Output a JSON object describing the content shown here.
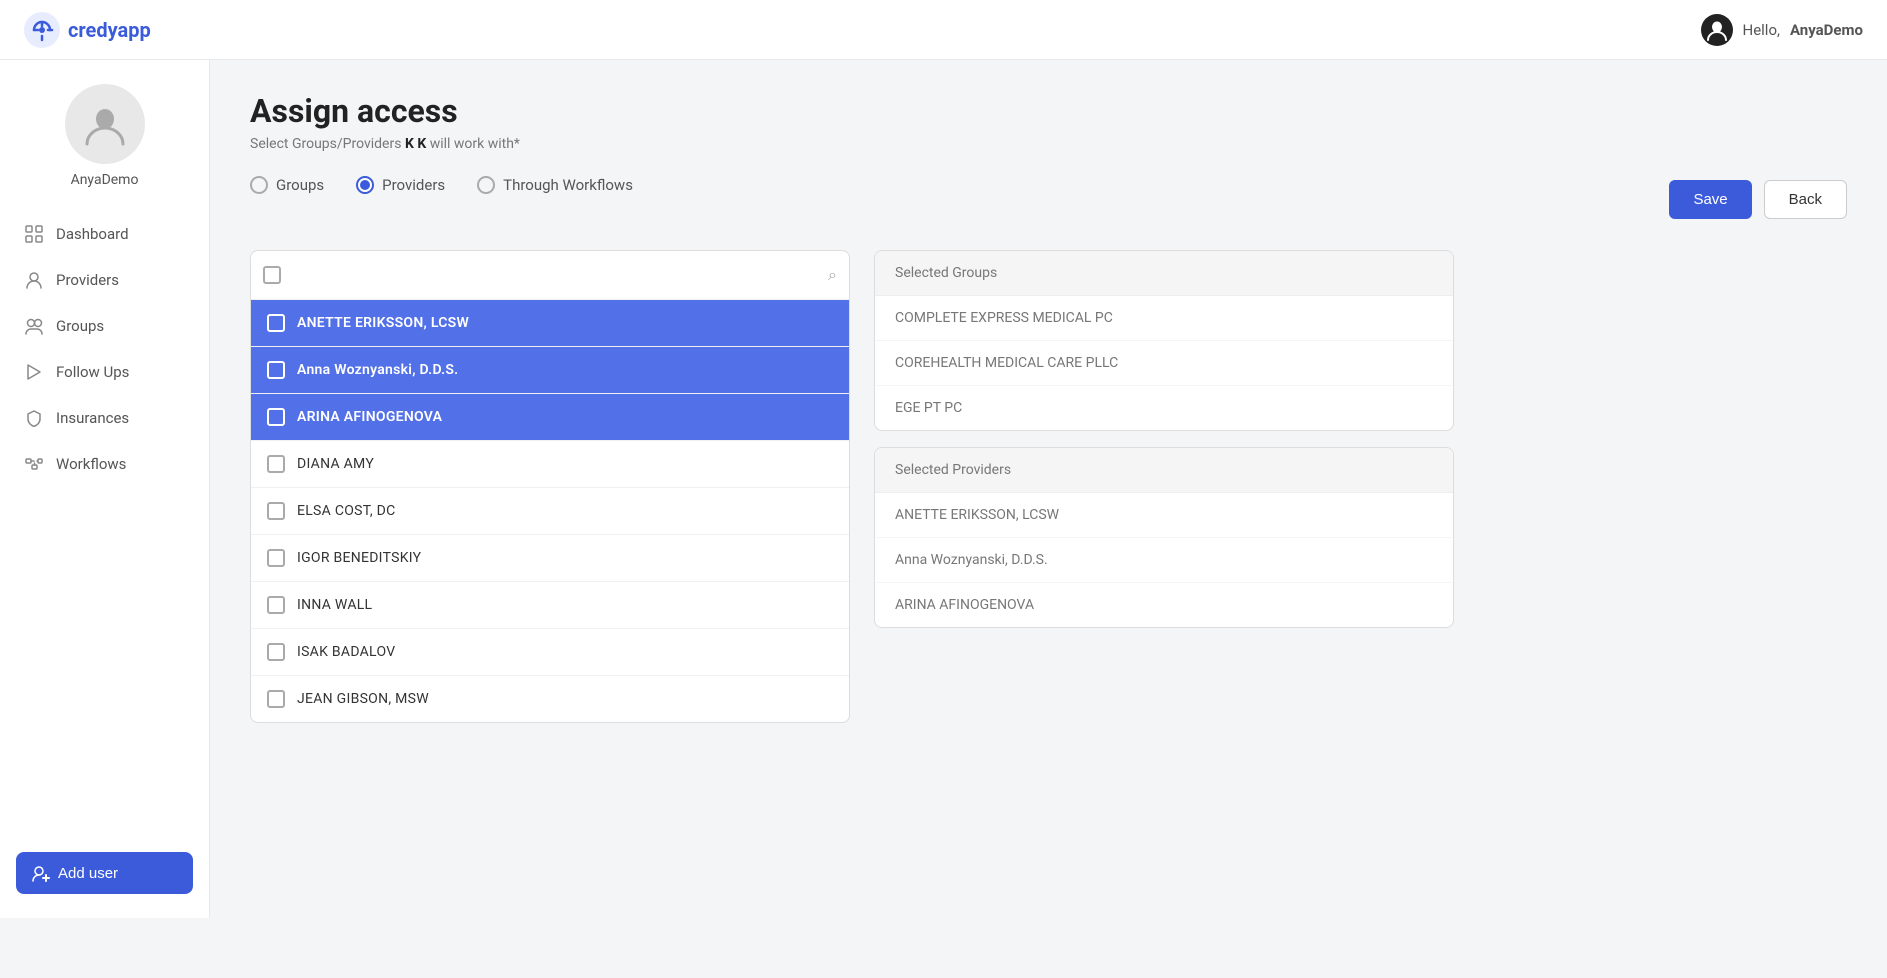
{
  "app": {
    "name": "credyapp",
    "logo_alt": "CredyApp Logo"
  },
  "header": {
    "greeting_prefix": "Hello, ",
    "username": "AnyaDemo"
  },
  "sidebar": {
    "profile_name": "AnyaDemo",
    "items": [
      {
        "id": "dashboard",
        "label": "Dashboard",
        "icon": "dashboard-icon"
      },
      {
        "id": "providers",
        "label": "Providers",
        "icon": "providers-icon"
      },
      {
        "id": "groups",
        "label": "Groups",
        "icon": "groups-icon"
      },
      {
        "id": "follow-ups",
        "label": "Follow Ups",
        "icon": "followups-icon"
      },
      {
        "id": "insurances",
        "label": "Insurances",
        "icon": "insurances-icon"
      },
      {
        "id": "workflows",
        "label": "Workflows",
        "icon": "workflows-icon"
      }
    ],
    "add_user_label": "Add user"
  },
  "page": {
    "title": "Assign access",
    "subtitle_prefix": "Select Groups/Providers ",
    "subtitle_user": "K K",
    "subtitle_suffix": " will work with*"
  },
  "radio_options": [
    {
      "id": "groups",
      "label": "Groups",
      "selected": false
    },
    {
      "id": "providers",
      "label": "Providers",
      "selected": true
    },
    {
      "id": "through-workflows",
      "label": "Through Workflows",
      "selected": false
    }
  ],
  "buttons": {
    "save": "Save",
    "back": "Back"
  },
  "search": {
    "placeholder": ""
  },
  "providers_list": [
    {
      "name": "ANETTE ERIKSSON, LCSW",
      "selected": true
    },
    {
      "name": "Anna Woznyanski, D.D.S.",
      "selected": true
    },
    {
      "name": "ARINA AFINOGENOVA",
      "selected": true
    },
    {
      "name": "DIANA AMY",
      "selected": false
    },
    {
      "name": "ELSA COST, DC",
      "selected": false
    },
    {
      "name": "IGOR BENEDITSKIY",
      "selected": false
    },
    {
      "name": "INNA WALL",
      "selected": false
    },
    {
      "name": "ISAK BADALOV",
      "selected": false
    },
    {
      "name": "JEAN GIBSON, MSW",
      "selected": false
    }
  ],
  "selected_groups_panel": {
    "header": "Selected Groups",
    "items": [
      "COMPLETE EXPRESS MEDICAL PC",
      "COREHEALTH MEDICAL CARE PLLC",
      "EGE PT PC"
    ]
  },
  "selected_providers_panel": {
    "header": "Selected Providers",
    "items": [
      "ANETTE ERIKSSON, LCSW",
      "Anna Woznyanski, D.D.S.",
      "ARINA AFINOGENOVA"
    ]
  }
}
